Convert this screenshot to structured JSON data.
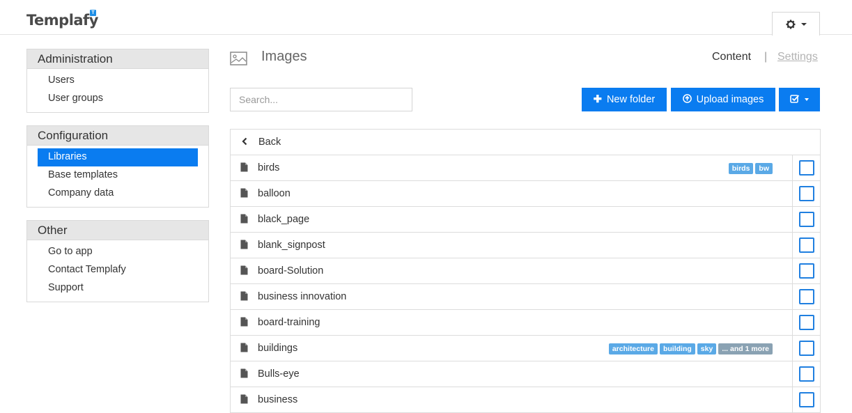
{
  "app": {
    "logo_text": "Templafy",
    "logo_badge": "T"
  },
  "sidebar": {
    "panels": [
      {
        "title": "Administration",
        "items": [
          "Users",
          "User groups"
        ]
      },
      {
        "title": "Configuration",
        "items": [
          "Libraries",
          "Base templates",
          "Company data"
        ],
        "active": "Libraries"
      },
      {
        "title": "Other",
        "items": [
          "Go to app",
          "Contact Templafy",
          "Support"
        ]
      }
    ]
  },
  "header": {
    "title": "Images",
    "tabs": {
      "content": "Content",
      "separator": "|",
      "settings": "Settings"
    }
  },
  "toolbar": {
    "search_placeholder": "Search...",
    "new_folder": "New folder",
    "upload_images": "Upload images"
  },
  "list": {
    "back_label": "Back",
    "rows": [
      {
        "name": "birds",
        "tags": [
          "birds",
          "bw"
        ]
      },
      {
        "name": "balloon",
        "tags": []
      },
      {
        "name": "black_page",
        "tags": []
      },
      {
        "name": "blank_signpost",
        "tags": []
      },
      {
        "name": "board-Solution",
        "tags": []
      },
      {
        "name": "business innovation",
        "tags": []
      },
      {
        "name": "board-training",
        "tags": []
      },
      {
        "name": "buildings",
        "tags": [
          "architecture",
          "building",
          "sky"
        ],
        "more": "... and 1 more"
      },
      {
        "name": "Bulls-eye",
        "tags": []
      },
      {
        "name": "business",
        "tags": []
      }
    ]
  },
  "colors": {
    "accent": "#0a7cf0",
    "tag": "#5aa9e6",
    "tag_more": "#8aa2b3"
  }
}
